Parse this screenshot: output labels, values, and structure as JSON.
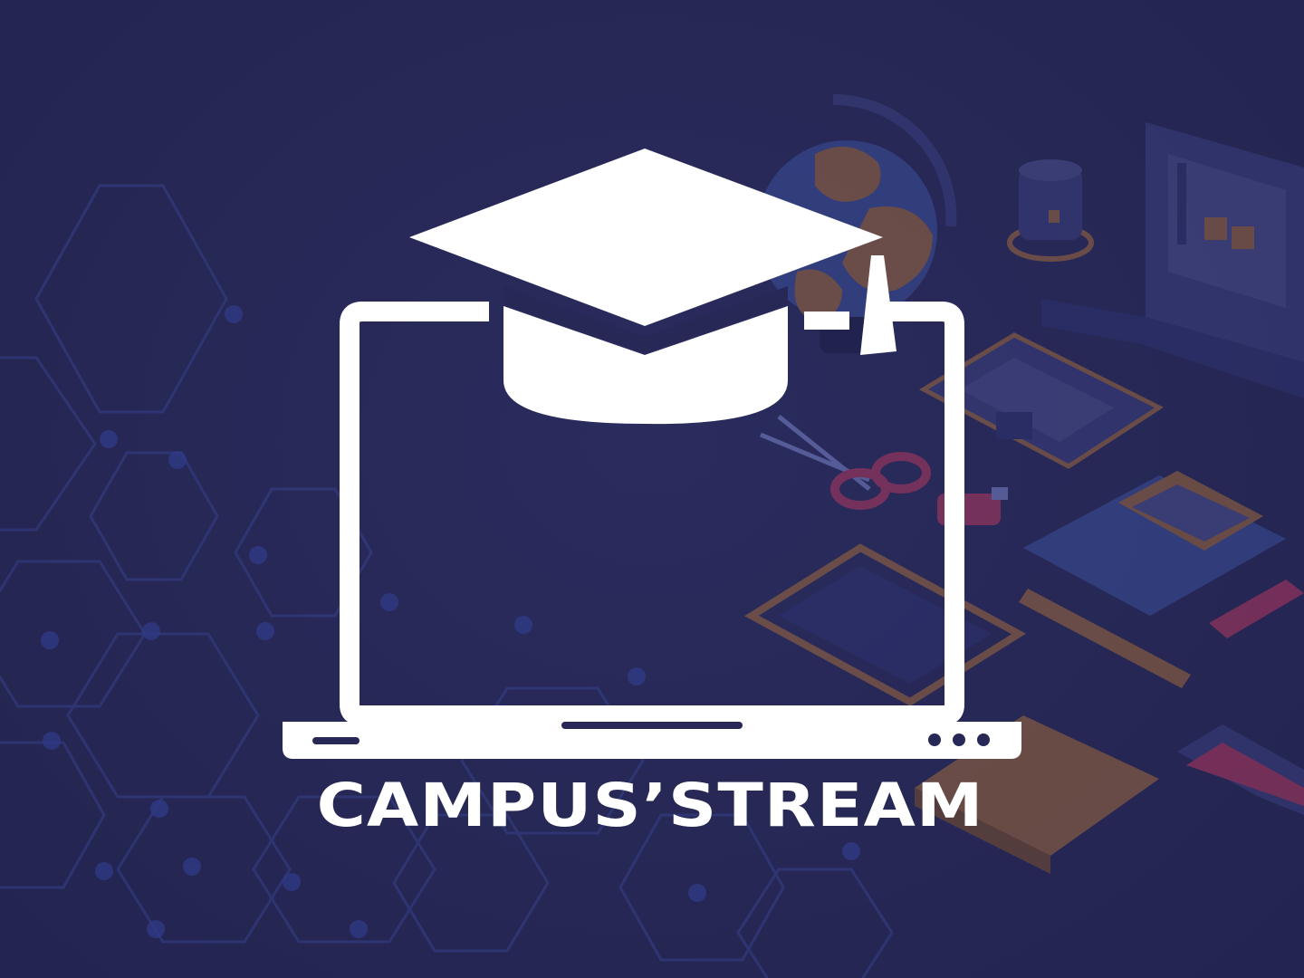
{
  "brand": {
    "name": "CAMPUS’STREAM"
  },
  "logo": {
    "icon": "laptop-with-graduation-cap-icon",
    "color": "#ffffff"
  },
  "background": {
    "base_color": "#272856",
    "pattern": "hexagon-network",
    "illustration_items": [
      "globe-icon",
      "laptop-icon",
      "coffee-cup-icon",
      "notebook-icon",
      "scissors-icon",
      "usb-drive-icon",
      "calculator-icon",
      "ruler-icon",
      "tablet-icon",
      "stapler-icon",
      "book-icon"
    ],
    "accent_colors": {
      "orange": "#a06a3c",
      "pink": "#b3385e",
      "blue": "#3b4f9a"
    }
  }
}
